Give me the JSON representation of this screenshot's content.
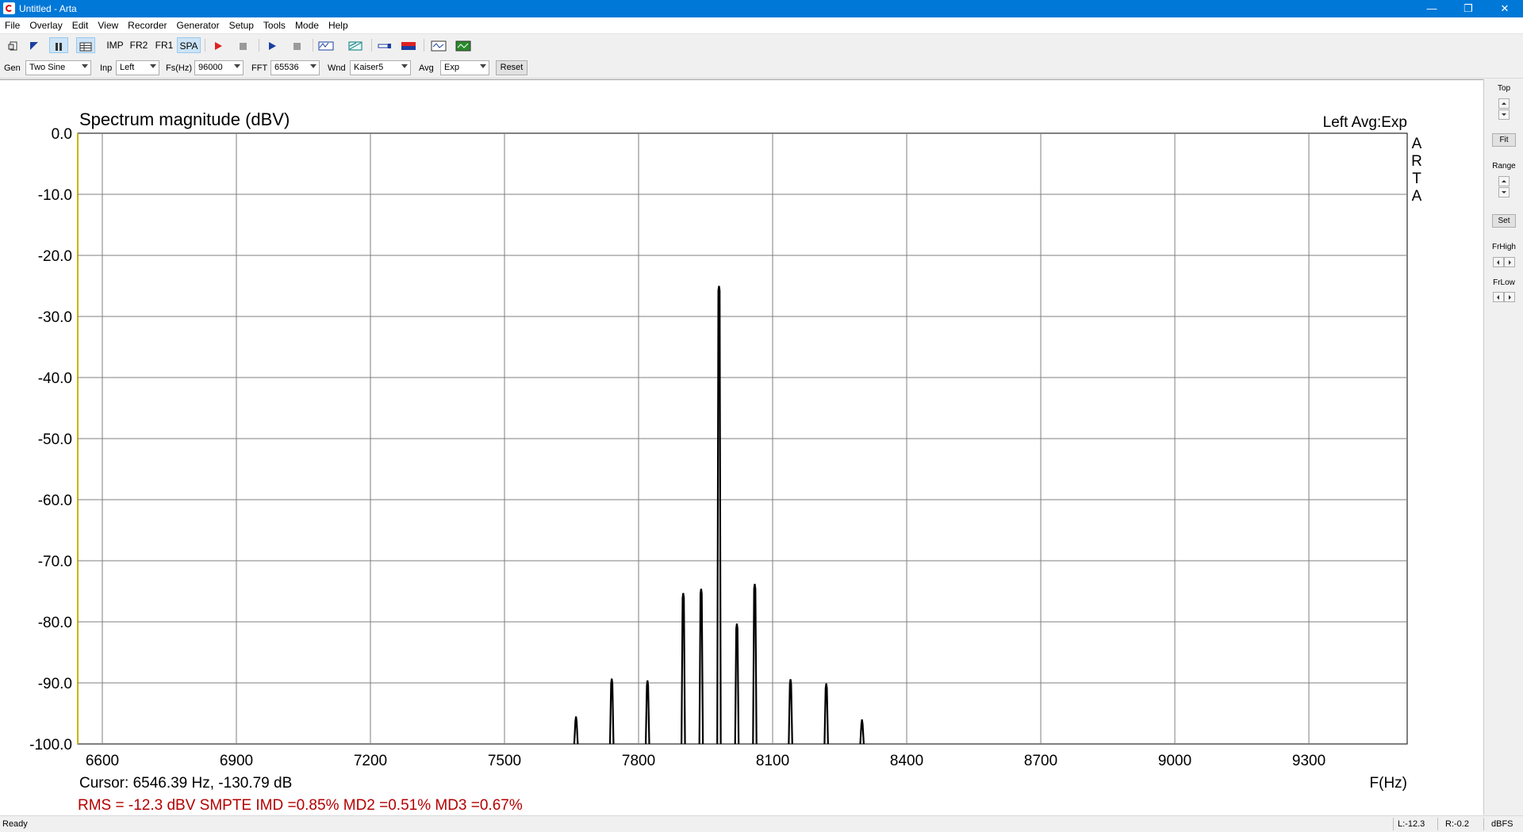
{
  "window": {
    "title": "Untitled - Arta",
    "minimize": "—",
    "restore": "❐",
    "close": "✕"
  },
  "menu": [
    "File",
    "Overlay",
    "Edit",
    "View",
    "Recorder",
    "Generator",
    "Setup",
    "Tools",
    "Mode",
    "Help"
  ],
  "toolbar": {
    "imp": "IMP",
    "fr2": "FR2",
    "fr1": "FR1",
    "spa": "SPA",
    "active_mode": "SPA"
  },
  "controls": {
    "gen_label": "Gen",
    "gen_value": "Two Sine",
    "inp_label": "Inp",
    "inp_value": "Left",
    "fs_label": "Fs(Hz)",
    "fs_value": "96000",
    "fft_label": "FFT",
    "fft_value": "65536",
    "wnd_label": "Wnd",
    "wnd_value": "Kaiser5",
    "avg_label": "Avg",
    "avg_value": "Exp",
    "reset": "Reset"
  },
  "right_panel": {
    "top": "Top",
    "fit": "Fit",
    "range": "Range",
    "set": "Set",
    "frhigh": "FrHigh",
    "frlow": "FrLow"
  },
  "plot": {
    "channel_avg": "Left  Avg:Exp",
    "watermark": [
      "A",
      "R",
      "T",
      "A"
    ],
    "cursor": "Cursor: 6546.39 Hz, -130.79 dB",
    "stats": "RMS =  -12.3 dBV  SMPTE IMD =0.85%  MD2 =0.51%  MD3 =0.67%"
  },
  "chart_data": {
    "type": "line",
    "title": "Spectrum magnitude (dBV)",
    "xlabel": "F(Hz)",
    "ylabel": "",
    "xlim": [
      6545,
      9520
    ],
    "ylim": [
      -100,
      0
    ],
    "x_ticks": [
      6600,
      6900,
      7200,
      7500,
      7800,
      8100,
      8400,
      8700,
      9000,
      9300
    ],
    "y_ticks": [
      0,
      -10,
      -20,
      -30,
      -40,
      -50,
      -60,
      -70,
      -80,
      -90,
      -100
    ],
    "y_tick_labels": [
      "0.0",
      "-10.0",
      "-20.0",
      "-30.0",
      "-40.0",
      "-50.0",
      "-60.0",
      "-70.0",
      "-80.0",
      "-90.0",
      "-100.0"
    ],
    "grid": true,
    "line_color": "#000000",
    "peaks": [
      {
        "x": 7660,
        "y": -95.5
      },
      {
        "x": 7740,
        "y": -89.3
      },
      {
        "x": 7820,
        "y": -89.6
      },
      {
        "x": 7900,
        "y": -75.3
      },
      {
        "x": 7940,
        "y": -74.6
      },
      {
        "x": 7980,
        "y": -25.0
      },
      {
        "x": 8020,
        "y": -80.3
      },
      {
        "x": 8060,
        "y": -73.8
      },
      {
        "x": 8140,
        "y": -89.4
      },
      {
        "x": 8220,
        "y": -90.1
      },
      {
        "x": 8300,
        "y": -96.0
      }
    ]
  },
  "status": {
    "left": "Ready",
    "l": "L:-12.3",
    "r": "R:-0.2",
    "unit": "dBFS"
  },
  "colors": {
    "titlebar": "#0078d7",
    "stats_text": "#b40000",
    "grid": "#7f7f7f",
    "left_marker": "#c8b400"
  }
}
